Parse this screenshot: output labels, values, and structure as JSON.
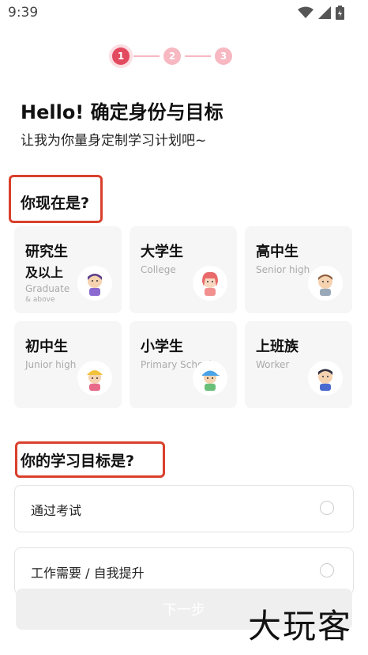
{
  "status_bar": {
    "time": "9:39",
    "icons": [
      "wifi-icon",
      "signal-icon",
      "battery-icon"
    ]
  },
  "stepper": {
    "steps": [
      "1",
      "2",
      "3"
    ],
    "active_step": 1
  },
  "header": {
    "title": "Hello!  确定身份与目标",
    "subtitle": "让我为你量身定制学习计划吧~"
  },
  "identity": {
    "question": "你现在是?",
    "options": [
      {
        "title": "研究生",
        "title2": "及以上",
        "en": "Graduate",
        "en2": "& above"
      },
      {
        "title": "大学生",
        "en": "College"
      },
      {
        "title": "高中生",
        "en": "Senior high"
      },
      {
        "title": "初中生",
        "en": "Junior high"
      },
      {
        "title": "小学生",
        "en": "Primary School"
      },
      {
        "title": "上班族",
        "en": "Worker"
      }
    ]
  },
  "goal": {
    "question": "你的学习目标是?",
    "options": [
      "通过考试",
      "工作需要 / 自我提升"
    ]
  },
  "next_button": "下一步",
  "watermark": "大玩客",
  "colors": {
    "accent": "#e24a5f",
    "step_pending": "#f7b8c2",
    "highlight_box": "#d9402c"
  }
}
